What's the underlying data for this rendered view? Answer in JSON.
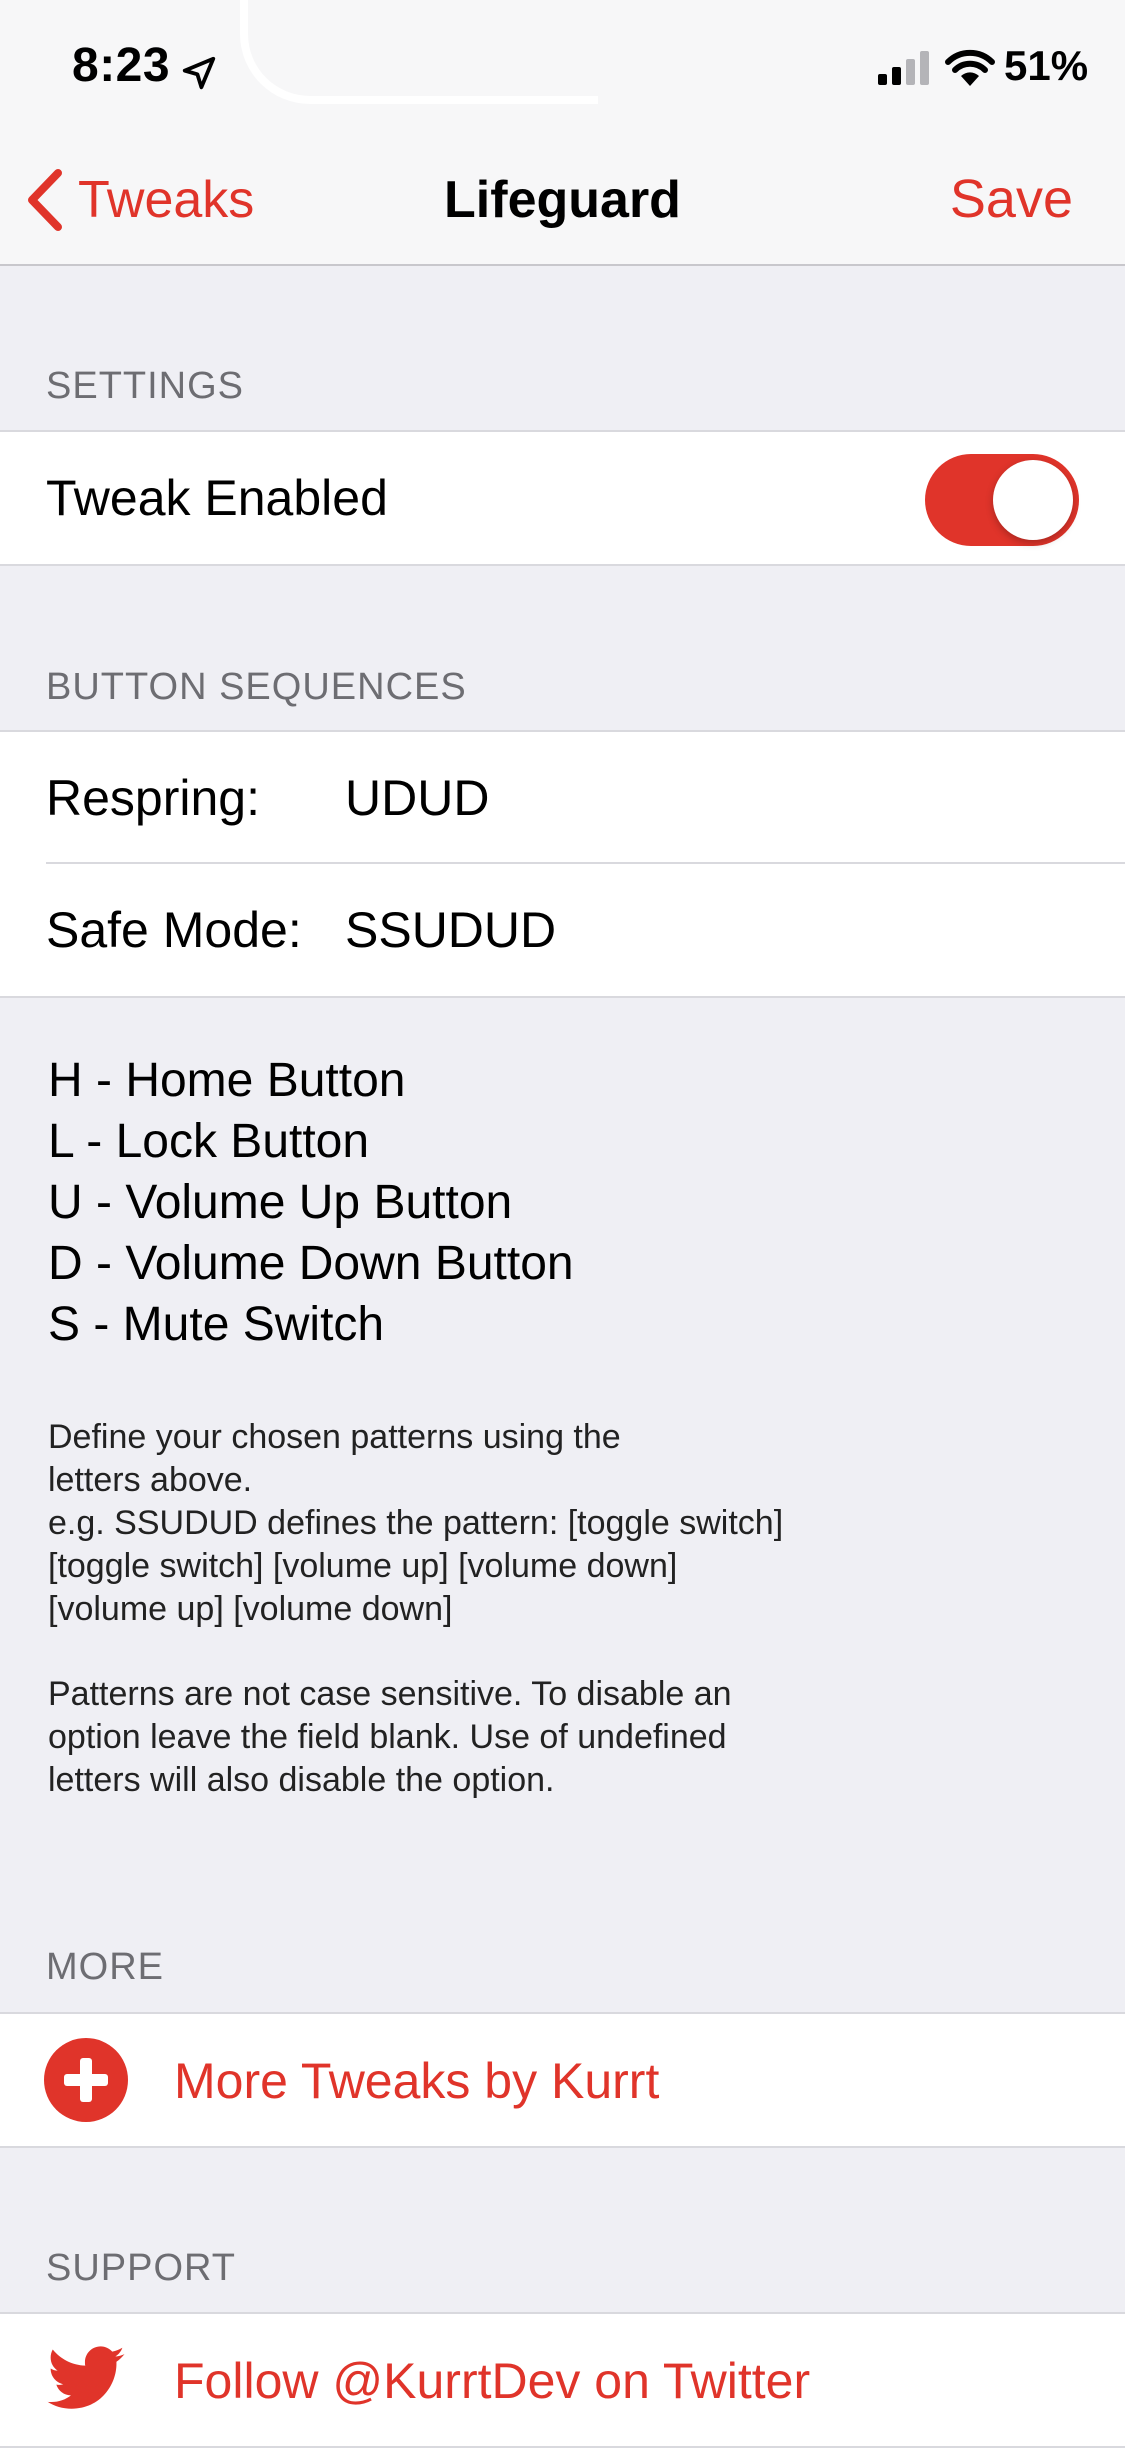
{
  "status_bar": {
    "time": "8:23",
    "battery": "51%"
  },
  "nav": {
    "back_label": "Tweaks",
    "title": "Lifeguard",
    "save_label": "Save"
  },
  "settings": {
    "header": "SETTINGS",
    "tweak_enabled_label": "Tweak Enabled",
    "tweak_enabled": true
  },
  "button_sequences": {
    "header": "BUTTON SEQUENCES",
    "rows": [
      {
        "label": "Respring:",
        "value": "UDUD"
      },
      {
        "label": "Safe Mode:",
        "value": "SSUDUD"
      }
    ],
    "legend": [
      "H - Home Button",
      "L - Lock Button",
      "U - Volume Up Button",
      "D - Volume Down Button",
      "S - Mute Switch"
    ],
    "footer_1": [
      "Define your chosen patterns using the",
      "letters above.",
      "e.g. SSUDUD defines the pattern: [toggle switch]",
      "[toggle switch] [volume up] [volume down]",
      "[volume up] [volume down]"
    ],
    "footer_2": [
      "Patterns are not case sensitive. To disable an",
      "option leave the field blank. Use of undefined",
      "letters will also disable the option."
    ]
  },
  "more": {
    "header": "MORE",
    "link_label": "More Tweaks by Kurrt",
    "icon": "plus-circle-icon"
  },
  "support": {
    "header": "SUPPORT",
    "link_label": "Follow @KurrtDev on Twitter",
    "icon": "twitter-bird-icon"
  },
  "colors": {
    "accent": "#E0342A",
    "background": "#EFEFF4",
    "header_text": "#6D6D72"
  }
}
